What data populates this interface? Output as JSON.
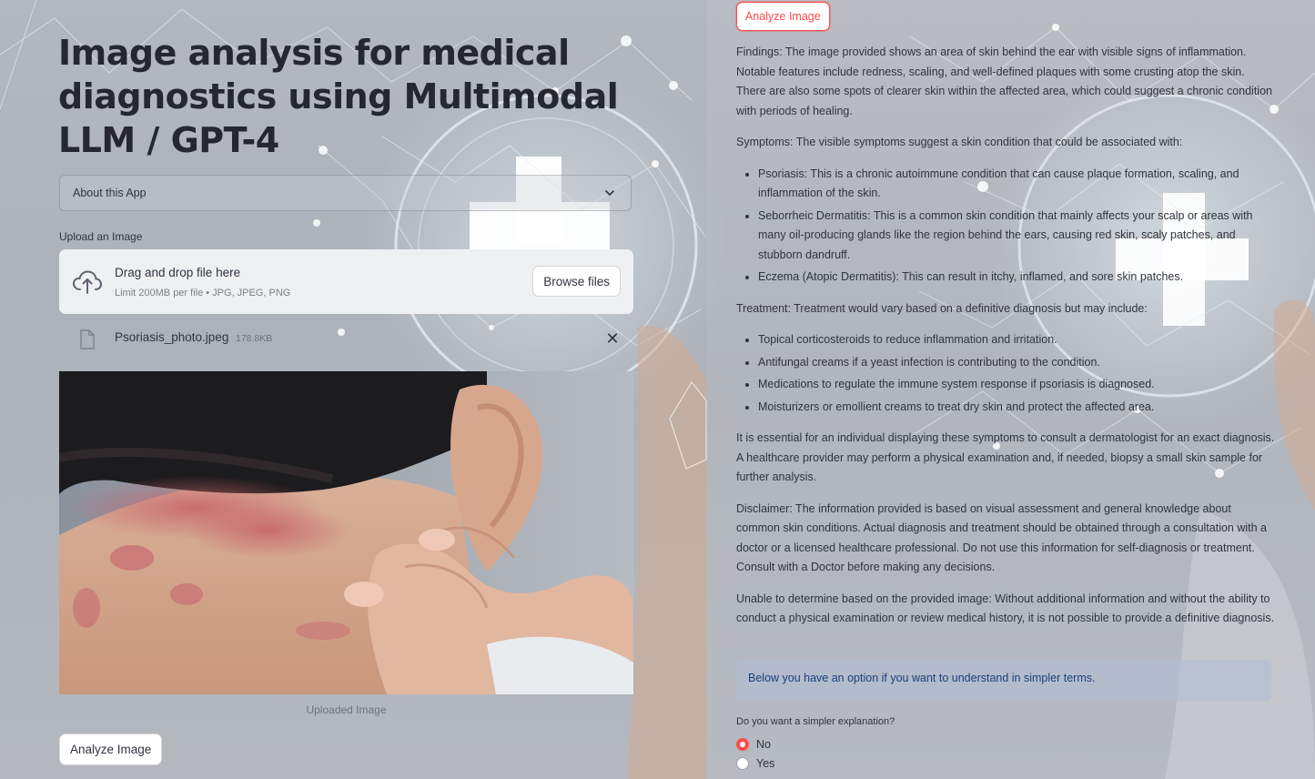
{
  "app": {
    "title": "Image analysis for medical diagnostics using Multimodal LLM / GPT-4",
    "expander_label": "About this App"
  },
  "upload": {
    "label": "Upload an Image",
    "drop_title": "Drag and drop file here",
    "limit_text": "Limit 200MB per file • JPG, JPEG, PNG",
    "browse_label": "Browse files",
    "file_name": "Psoriasis_photo.jpeg",
    "file_size": "178.8KB",
    "remove_symbol": "✕",
    "caption": "Uploaded Image"
  },
  "buttons": {
    "analyze_left": "Analyze Image",
    "analyze_right": "Analyze Image"
  },
  "result": {
    "findings": "Findings: The image provided shows an area of skin behind the ear with visible signs of inflammation. Notable features include redness, scaling, and well-defined plaques with some crusting atop the skin. There are also some spots of clearer skin within the affected area, which could suggest a chronic condition with periods of healing.",
    "symptoms_intro": "Symptoms: The visible symptoms suggest a skin condition that could be associated with:",
    "symptoms": [
      "Psoriasis: This is a chronic autoimmune condition that can cause plaque formation, scaling, and inflammation of the skin.",
      "Seborrheic Dermatitis: This is a common skin condition that mainly affects your scalp or areas with many oil-producing glands like the region behind the ears, causing red skin, scaly patches, and stubborn dandruff.",
      "Eczema (Atopic Dermatitis): This can result in itchy, inflamed, and sore skin patches."
    ],
    "treatment_intro": "Treatment: Treatment would vary based on a definitive diagnosis but may include:",
    "treatments": [
      "Topical corticosteroids to reduce inflammation and irritation.",
      "Antifungal creams if a yeast infection is contributing to the condition.",
      "Medications to regulate the immune system response if psoriasis is diagnosed.",
      "Moisturizers or emollient creams to treat dry skin and protect the affected area."
    ],
    "consult": "It is essential for an individual displaying these symptoms to consult a dermatologist for an exact diagnosis. A healthcare provider may perform a physical examination and, if needed, biopsy a small skin sample for further analysis.",
    "disclaimer": "Disclaimer: The information provided is based on visual assessment and general knowledge about common skin conditions. Actual diagnosis and treatment should be obtained through a consultation with a doctor or a licensed healthcare professional. Do not use this information for self-diagnosis or treatment. Consult with a Doctor before making any decisions.",
    "unable": "Unable to determine based on the provided image: Without additional information and without the ability to conduct a physical examination or review medical history, it is not possible to provide a definitive diagnosis."
  },
  "info_box": "Below you have an option if you want to understand in simpler terms.",
  "simpler": {
    "question": "Do you want a simpler explanation?",
    "options": [
      "No",
      "Yes"
    ],
    "selected": "No"
  },
  "colors": {
    "accent": "#ff4b4b",
    "info_text": "#1a4277",
    "info_bg": "#b0bed6"
  }
}
